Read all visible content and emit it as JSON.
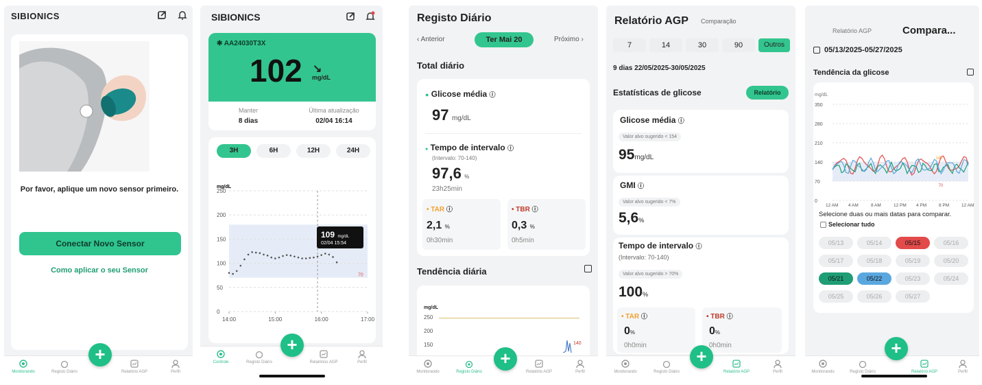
{
  "colors": {
    "accent": "#2cbe8c",
    "tar": "#f0a030",
    "tbr": "#c0392b",
    "red": "#e34a4a",
    "blue": "#5aa7e0"
  },
  "s1": {
    "brand": "SIBIONICS",
    "message": "Por favor, aplique um novo sensor primeiro.",
    "connect_btn": "Conectar Novo Sensor",
    "how_link": "Como aplicar o seu Sensor",
    "nav": {
      "monitor": "Monitorando",
      "registo": "Registo Diário",
      "agp": "Relatório AGP",
      "perfil": "Perfil"
    }
  },
  "s2": {
    "brand": "SIBIONICS",
    "sensor_id": "AA24030T3X",
    "glucose": "102",
    "unit": "mg/dL",
    "keep_label": "Manter",
    "keep_value": "8 dias",
    "update_label": "Última atualização",
    "update_value": "02/04 16:14",
    "ranges": [
      "3H",
      "6H",
      "12H",
      "24H"
    ],
    "ylabel": "mg/dL",
    "tooltip_value": "109",
    "tooltip_unit": "mg/dL",
    "tooltip_time": "02/04 15:54",
    "low_label": "70",
    "nav": {
      "monitor": "Controle",
      "registo": "Registo Diário",
      "agp": "Relatórios AGP",
      "perfil": "Perfil"
    }
  },
  "chart_data": {
    "type": "scatter",
    "ylabel": "mg/dL",
    "x_ticks": [
      "14:00",
      "15:00",
      "16:00",
      "17:00"
    ],
    "y_ticks": [
      "0",
      "50",
      "100",
      "150",
      "200",
      "250"
    ],
    "ylim": [
      0,
      250
    ],
    "target_range": [
      70,
      180
    ],
    "x": [
      0,
      5,
      10,
      15,
      20,
      25,
      30,
      35,
      40,
      45,
      50,
      55,
      60,
      65,
      70,
      75,
      80,
      85,
      90,
      95,
      100,
      105,
      110,
      115,
      120,
      125,
      130,
      135,
      140
    ],
    "values": [
      80,
      78,
      84,
      95,
      108,
      118,
      123,
      122,
      121,
      118,
      116,
      112,
      110,
      112,
      115,
      117,
      116,
      114,
      112,
      110,
      110,
      111,
      112,
      114,
      117,
      120,
      118,
      113,
      102
    ]
  },
  "s3": {
    "title": "Registo Diário",
    "prev": "Anterior",
    "date": "Ter Mai 20",
    "next": "Próximo",
    "total": "Total diário",
    "avg_label": "Glicose média",
    "avg_value": "97",
    "avg_unit": "mg/dL",
    "tir_label": "Tempo de intervalo",
    "tir_range": "(Intervalo: 70-140)",
    "tir_value": "97,6",
    "tir_unit": "%",
    "tir_time": "23h25min",
    "tar_label": "TAR",
    "tar_value": "2,1",
    "tar_unit": "%",
    "tar_time": "0h30min",
    "tbr_label": "TBR",
    "tbr_value": "0,3",
    "tbr_unit": "%",
    "tbr_time": "0h5min",
    "trend": "Tendência diária",
    "ylabel": "mg/dL",
    "yticks": [
      "250",
      "200",
      "150"
    ],
    "peak": "140",
    "nav": {
      "monitor": "Monitorando",
      "registo": "Registo Diário",
      "agp": "Relatório AGP",
      "perfil": "Perfil"
    }
  },
  "s4": {
    "title": "Relatório AGP",
    "compare": "Comparação",
    "ranges": [
      "7",
      "14",
      "30",
      "90",
      "Outros"
    ],
    "period": "9 dias 22/05/2025-30/05/2025",
    "stats": "Estatísticas de glicose",
    "report_btn": "Relatório",
    "avg_label": "Glicose média",
    "avg_hint": "Valor alvo sugerido < 154",
    "avg_value": "95",
    "avg_unit": "mg/dL",
    "gmi_label": "GMI",
    "gmi_hint": "Valor alvo sugerido < 7%",
    "gmi_value": "5,6",
    "gmi_unit": "%",
    "tir_label": "Tempo de intervalo",
    "tir_range": "(Intervalo: 70-140)",
    "tir_hint": "Valor alvo sugerido > 70%",
    "tir_value": "100",
    "tir_unit": "%",
    "tar_label": "TAR",
    "tar_value": "0",
    "tar_unit": "%",
    "tar_time": "0h0min",
    "tbr_label": "TBR",
    "tbr_value": "0",
    "tbr_unit": "%",
    "tbr_time": "0h0min",
    "nav": {
      "monitor": "Monitorando",
      "registo": "Registo Diário",
      "agp": "Relatório AGP",
      "perfil": "Perfil"
    }
  },
  "s5": {
    "tab_agp": "Relatório AGP",
    "tab_compare": "Compara...",
    "daterange": "05/13/2025-05/27/2025",
    "trend": "Tendência da glicose",
    "ylabel": "mg/dL",
    "yticks": [
      "350",
      "280",
      "210",
      "140",
      "70",
      "0"
    ],
    "xticks": [
      "12 AM",
      "4 AM",
      "8 AM",
      "12 PM",
      "4 PM",
      "8 PM",
      "12 AM"
    ],
    "peak": "142",
    "low": "70",
    "select_msg": "Selecione duas ou mais datas para comparar.",
    "select_all": "Selecionar tudo",
    "dates": [
      "05/13",
      "05/14",
      "05/15",
      "05/16",
      "05/17",
      "05/18",
      "05/19",
      "05/20",
      "05/21",
      "05/22",
      "05/23",
      "05/24",
      "05/25",
      "05/26",
      "05/27"
    ],
    "nav": {
      "monitor": "Monitorando",
      "registo": "Registo Diário",
      "agp": "Relatório AGP",
      "perfil": "Perfil"
    }
  }
}
